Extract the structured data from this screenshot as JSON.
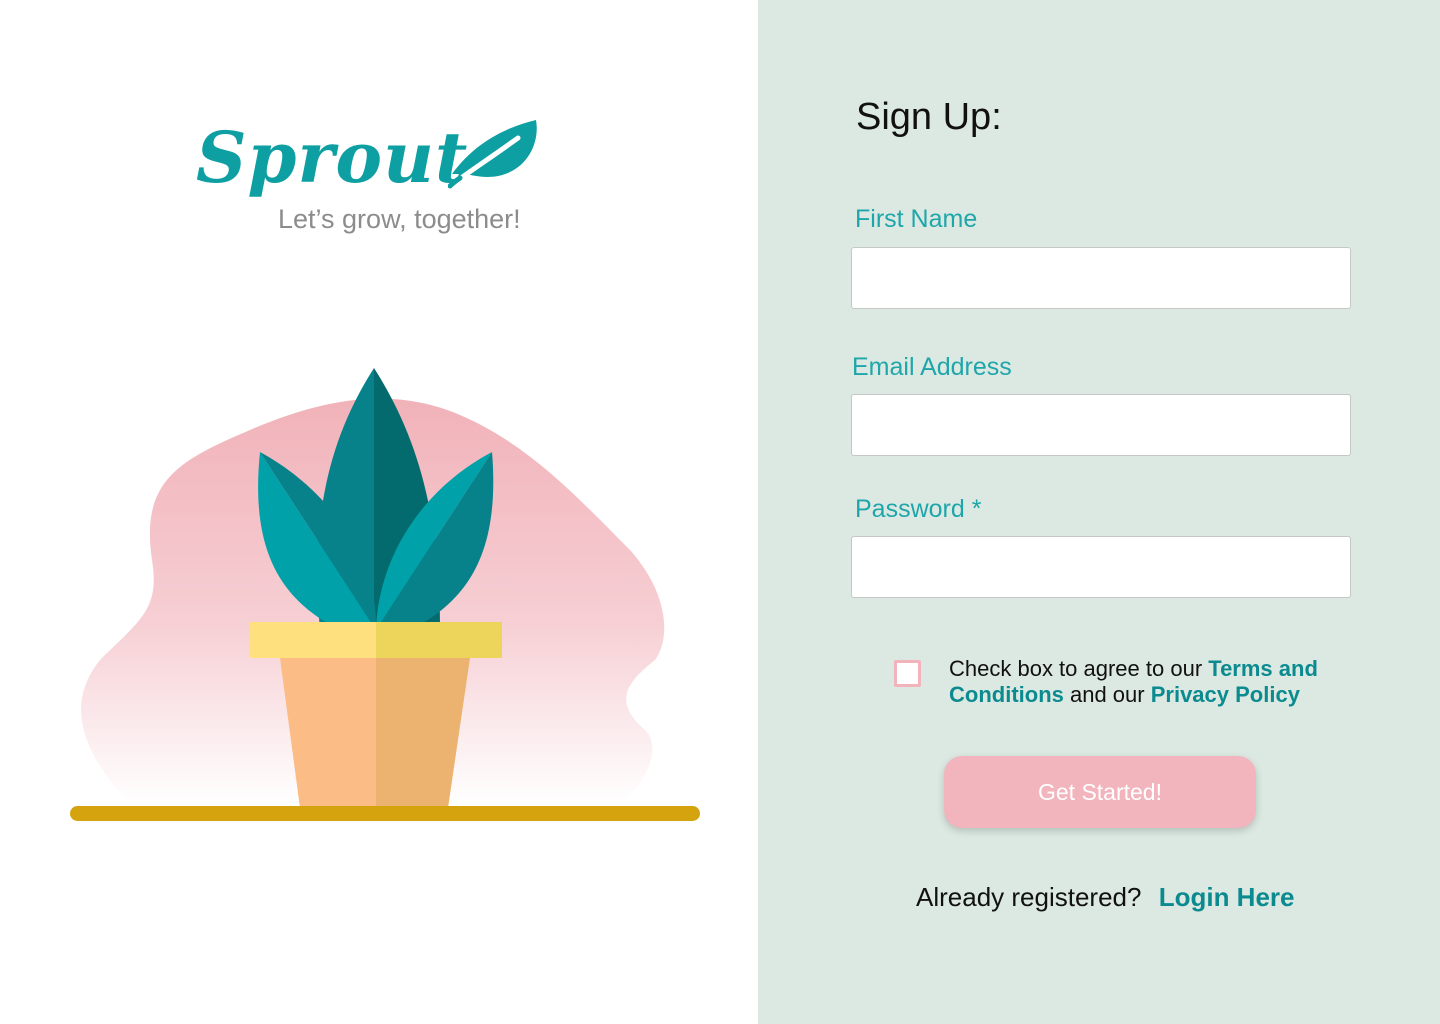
{
  "brand": {
    "name": "Sprout",
    "tagline": "Let’s grow, together!",
    "color": "#0e9fa3"
  },
  "illustration": {
    "subject": "potted-plant-icon",
    "colors": {
      "blob": "#f3b6bd",
      "leaf_dark": "#036b6e",
      "leaf_mid": "#07818a",
      "leaf_light": "#00a1a8",
      "pot_light": "#fbbd85",
      "pot_dark": "#ecb26f",
      "rim_light": "#ffe07f",
      "rim_dark": "#ecd55a",
      "shelf": "#d4a30e"
    }
  },
  "form": {
    "heading": "Sign Up:",
    "fields": [
      {
        "label": "First Name",
        "value": "",
        "placeholder": ""
      },
      {
        "label": "Email Address",
        "value": "",
        "placeholder": ""
      },
      {
        "label": "Password *",
        "value": "",
        "placeholder": ""
      }
    ],
    "agreement": {
      "prefix": "Check box to agree to our ",
      "terms_link": "Terms and Conditions",
      "middle": " and our ",
      "privacy_link": "Privacy Policy",
      "checked": false
    },
    "submit_label": "Get Started!",
    "login_prompt": "Already registered?",
    "login_link": "Login Here"
  },
  "colors": {
    "panel_bg": "#dce9e2",
    "label": "#1ea6aa",
    "link": "#0b8b90",
    "button": "#f2b5bd"
  }
}
